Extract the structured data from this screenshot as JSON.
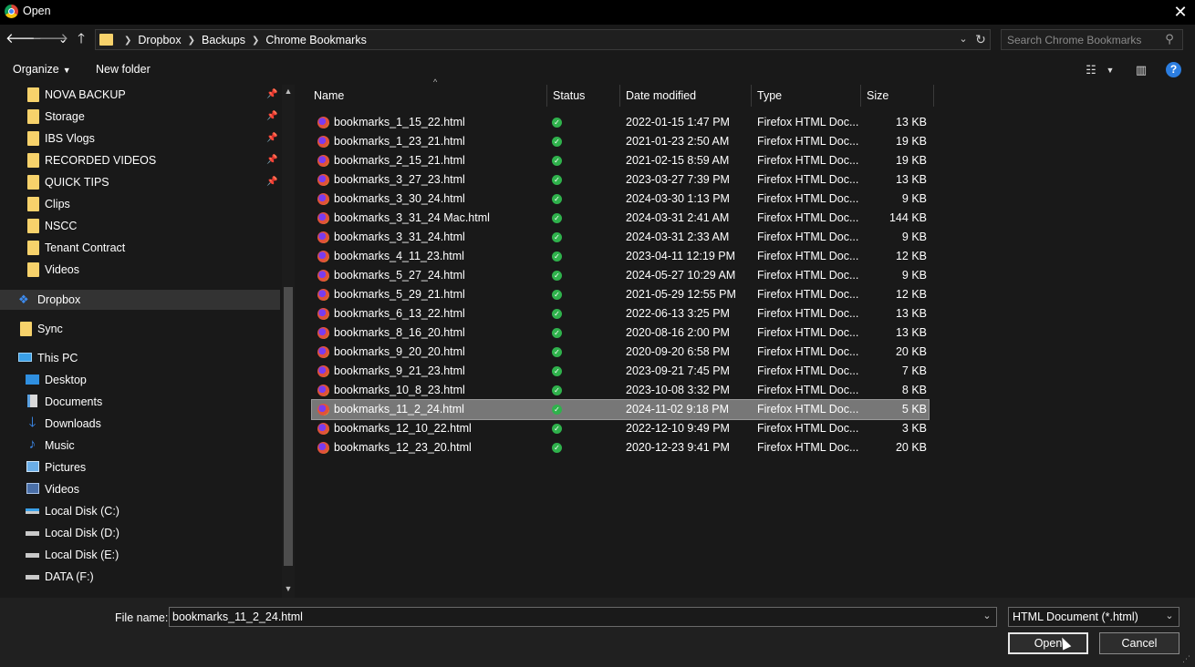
{
  "window": {
    "title": "Open",
    "close_glyph": "✕"
  },
  "nav": {
    "back": "🡐",
    "forward": "🡒",
    "recent": "⌄",
    "up": "🡑"
  },
  "address": {
    "crumbs": [
      "Dropbox",
      "Backups",
      "Chrome Bookmarks"
    ]
  },
  "search": {
    "placeholder": "Search Chrome Bookmarks"
  },
  "toolbar": {
    "organize_label": "Organize",
    "new_folder_label": "New folder"
  },
  "sidebar": {
    "quick_access": [
      {
        "label": "NOVA BACKUP",
        "pinned": true
      },
      {
        "label": "Storage",
        "pinned": true
      },
      {
        "label": "IBS Vlogs",
        "pinned": true
      },
      {
        "label": "RECORDED VIDEOS",
        "pinned": true
      },
      {
        "label": "QUICK TIPS",
        "pinned": true
      },
      {
        "label": "Clips",
        "pinned": false
      },
      {
        "label": "NSCC",
        "pinned": false
      },
      {
        "label": "Tenant Contract",
        "pinned": false
      },
      {
        "label": "Videos",
        "pinned": false
      }
    ],
    "dropbox": "Dropbox",
    "sync": "Sync",
    "this_pc": "This PC",
    "pc_items": [
      {
        "label": "Desktop",
        "icon": "desktop-icon"
      },
      {
        "label": "Documents",
        "icon": "documents-icon"
      },
      {
        "label": "Downloads",
        "icon": "downloads-icon"
      },
      {
        "label": "Music",
        "icon": "music-icon"
      },
      {
        "label": "Pictures",
        "icon": "pictures-icon"
      },
      {
        "label": "Videos",
        "icon": "videos-icon"
      },
      {
        "label": "Local Disk (C:)",
        "icon": "drive-c-icon"
      },
      {
        "label": "Local Disk (D:)",
        "icon": "drive-icon"
      },
      {
        "label": "Local Disk (E:)",
        "icon": "drive-icon"
      },
      {
        "label": "DATA (F:)",
        "icon": "drive-icon"
      }
    ]
  },
  "columns": [
    "Name",
    "Status",
    "Date modified",
    "Type",
    "Size"
  ],
  "files": [
    {
      "name": "bookmarks_1_15_22.html",
      "date": "2022-01-15 1:47 PM",
      "type": "Firefox HTML Doc...",
      "size": "13 KB"
    },
    {
      "name": "bookmarks_1_23_21.html",
      "date": "2021-01-23 2:50 AM",
      "type": "Firefox HTML Doc...",
      "size": "19 KB"
    },
    {
      "name": "bookmarks_2_15_21.html",
      "date": "2021-02-15 8:59 AM",
      "type": "Firefox HTML Doc...",
      "size": "19 KB"
    },
    {
      "name": "bookmarks_3_27_23.html",
      "date": "2023-03-27 7:39 PM",
      "type": "Firefox HTML Doc...",
      "size": "13 KB"
    },
    {
      "name": "bookmarks_3_30_24.html",
      "date": "2024-03-30 1:13 PM",
      "type": "Firefox HTML Doc...",
      "size": "9 KB"
    },
    {
      "name": "bookmarks_3_31_24 Mac.html",
      "date": "2024-03-31 2:41 AM",
      "type": "Firefox HTML Doc...",
      "size": "144 KB"
    },
    {
      "name": "bookmarks_3_31_24.html",
      "date": "2024-03-31 2:33 AM",
      "type": "Firefox HTML Doc...",
      "size": "9 KB"
    },
    {
      "name": "bookmarks_4_11_23.html",
      "date": "2023-04-11 12:19 PM",
      "type": "Firefox HTML Doc...",
      "size": "12 KB"
    },
    {
      "name": "bookmarks_5_27_24.html",
      "date": "2024-05-27 10:29 AM",
      "type": "Firefox HTML Doc...",
      "size": "9 KB"
    },
    {
      "name": "bookmarks_5_29_21.html",
      "date": "2021-05-29 12:55 PM",
      "type": "Firefox HTML Doc...",
      "size": "12 KB"
    },
    {
      "name": "bookmarks_6_13_22.html",
      "date": "2022-06-13 3:25 PM",
      "type": "Firefox HTML Doc...",
      "size": "13 KB"
    },
    {
      "name": "bookmarks_8_16_20.html",
      "date": "2020-08-16 2:00 PM",
      "type": "Firefox HTML Doc...",
      "size": "13 KB"
    },
    {
      "name": "bookmarks_9_20_20.html",
      "date": "2020-09-20 6:58 PM",
      "type": "Firefox HTML Doc...",
      "size": "20 KB"
    },
    {
      "name": "bookmarks_9_21_23.html",
      "date": "2023-09-21 7:45 PM",
      "type": "Firefox HTML Doc...",
      "size": "7 KB"
    },
    {
      "name": "bookmarks_10_8_23.html",
      "date": "2023-10-08 3:32 PM",
      "type": "Firefox HTML Doc...",
      "size": "8 KB"
    },
    {
      "name": "bookmarks_11_2_24.html",
      "date": "2024-11-02 9:18 PM",
      "type": "Firefox HTML Doc...",
      "size": "5 KB",
      "selected": true
    },
    {
      "name": "bookmarks_12_10_22.html",
      "date": "2022-12-10 9:49 PM",
      "type": "Firefox HTML Doc...",
      "size": "3 KB"
    },
    {
      "name": "bookmarks_12_23_20.html",
      "date": "2020-12-23 9:41 PM",
      "type": "Firefox HTML Doc...",
      "size": "20 KB"
    }
  ],
  "footer": {
    "filename_label": "File name:",
    "filename_value": "bookmarks_11_2_24.html",
    "filetype_value": "HTML Document (*.html)",
    "open_label": "Open",
    "cancel_label": "Cancel"
  },
  "colors": {
    "folder": "#f7d26b",
    "selection": "#777777",
    "status_ok": "#2fb24c",
    "help": "#2b7de0",
    "dropbox": "#3d8cf0"
  }
}
